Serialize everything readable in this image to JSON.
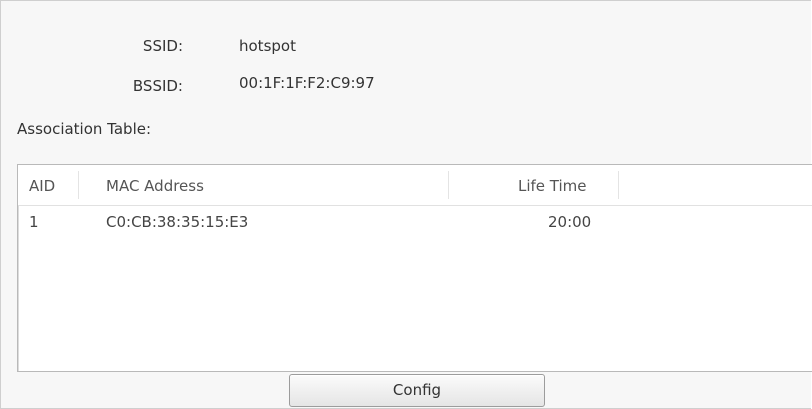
{
  "info": {
    "ssid_label": "SSID:",
    "ssid_value": "hotspot",
    "bssid_label": "BSSID:",
    "bssid_value": "00:1F:1F:F2:C9:97"
  },
  "association": {
    "title": "Association Table:",
    "columns": [
      "AID",
      "MAC Address",
      "Life Time"
    ],
    "rows": [
      {
        "aid": "1",
        "mac": "C0:CB:38:35:15:E3",
        "life_time": "20:00"
      }
    ]
  },
  "buttons": {
    "config_label": "Config"
  }
}
